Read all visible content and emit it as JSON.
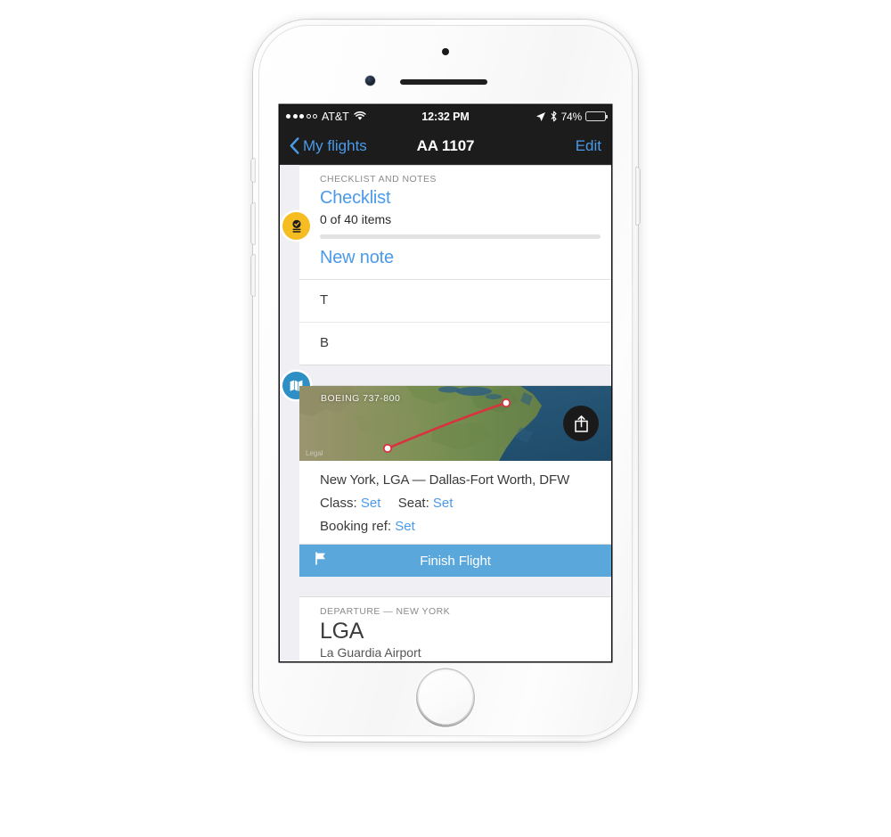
{
  "status_bar": {
    "signal_dots_filled": 3,
    "signal_dots_total": 5,
    "carrier": "AT&T",
    "wifi_icon": "wifi-icon",
    "time": "12:32 PM",
    "location_icon": "location-arrow-icon",
    "bluetooth_icon": "bluetooth-icon",
    "battery_percent": "74%",
    "battery_level": 74
  },
  "nav_bar": {
    "back_icon": "chevron-left-icon",
    "back_label": "My flights",
    "title": "AA 1107",
    "edit_label": "Edit"
  },
  "checklist_card": {
    "section_label": "CHECKLIST AND NOTES",
    "badge_icon": "checklist-badge-icon",
    "checklist_link": "Checklist",
    "items_status": "0 of 40 items",
    "progress_percent": 0,
    "new_note_label": "New note",
    "notes": [
      {
        "text": "T"
      },
      {
        "text": "B"
      }
    ]
  },
  "map_card": {
    "badge_icon": "map-badge-icon",
    "aircraft": "BOEING 737-800",
    "legal_label": "Legal",
    "share_icon": "share-icon",
    "route": "New York, LGA — Dallas-Fort Worth, DFW",
    "class_label": "Class:",
    "class_value": "Set",
    "seat_label": "Seat:",
    "seat_value": "Set",
    "booking_label": "Booking ref:",
    "booking_value": "Set"
  },
  "finish_button": {
    "icon": "flag-icon",
    "label": "Finish Flight"
  },
  "departure_card": {
    "section_label": "DEPARTURE — NEW YORK",
    "code": "LGA",
    "airport_name": "La Guardia Airport"
  },
  "colors": {
    "accent_blue": "#4b9ae8",
    "button_blue": "#5aa7dc",
    "badge_yellow": "#f5bd21",
    "badge_blue": "#2e8fc4",
    "route_red": "#d8333f",
    "status_bar_bg": "#1c1c1c",
    "screen_bg": "#efeff4"
  }
}
